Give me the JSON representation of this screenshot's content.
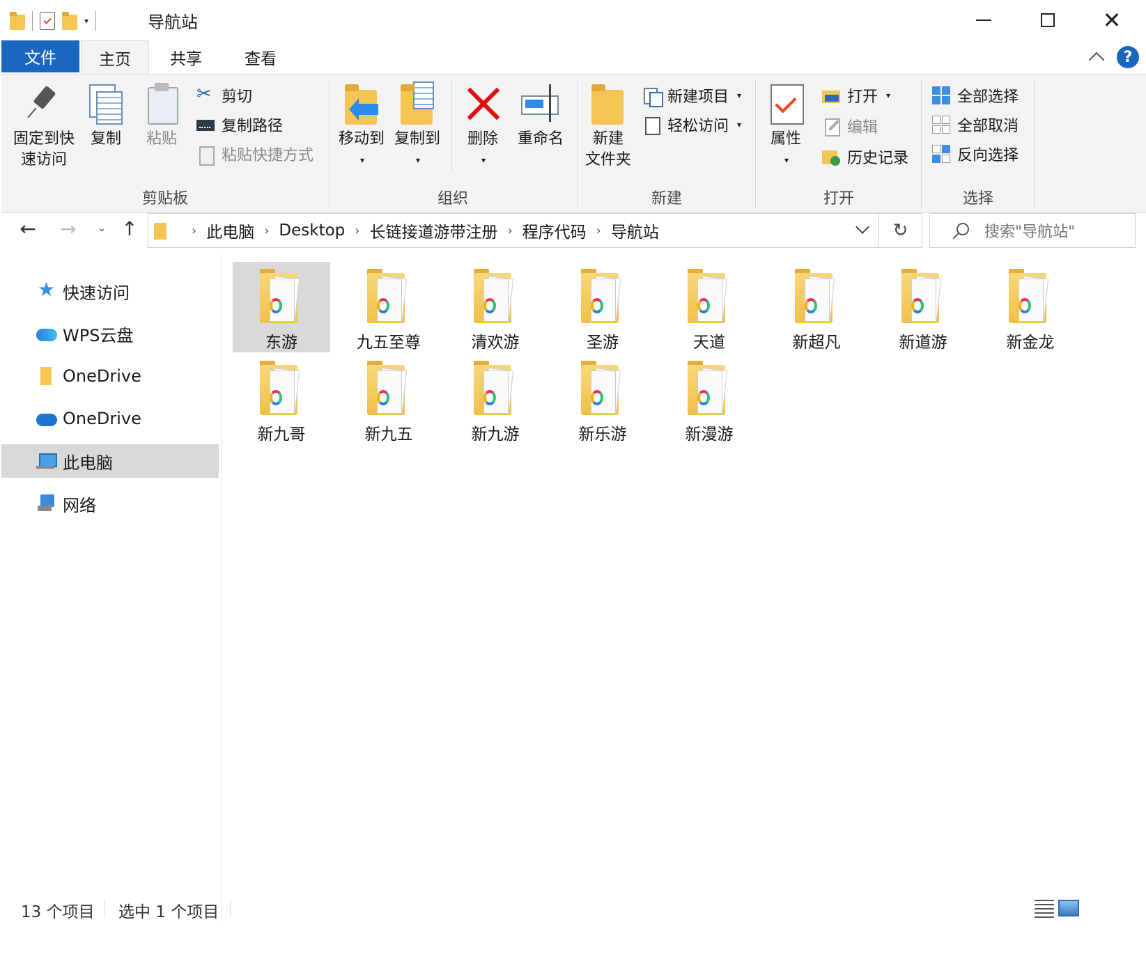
{
  "window": {
    "title": "导航站",
    "qat_dropdown": "▾",
    "minimize": "",
    "maximize": "",
    "close": "✕"
  },
  "tabs": {
    "file": "文件",
    "home": "主页",
    "share": "共享",
    "view": "查看",
    "help": "?"
  },
  "ribbon": {
    "clipboard": {
      "label": "剪贴板",
      "pin_line1": "固定到快",
      "pin_line2": "速访问",
      "copy": "复制",
      "paste": "粘贴",
      "cut": "剪切",
      "copy_path": "复制路径",
      "paste_shortcut": "粘贴快捷方式"
    },
    "organize": {
      "label": "组织",
      "move_to": "移动到",
      "copy_to": "复制到",
      "delete": "删除",
      "rename": "重命名"
    },
    "new": {
      "label": "新建",
      "new_folder_line1": "新建",
      "new_folder_line2": "文件夹",
      "new_item": "新建项目",
      "easy_access": "轻松访问"
    },
    "open": {
      "label": "打开",
      "properties": "属性",
      "open": "打开",
      "edit": "编辑",
      "history": "历史记录"
    },
    "select": {
      "label": "选择",
      "select_all": "全部选择",
      "select_none": "全部取消",
      "invert": "反向选择"
    }
  },
  "nav": {
    "back": "←",
    "forward": "→",
    "recent": "⌄",
    "up": "↑",
    "refresh": "↻"
  },
  "breadcrumb": [
    "此电脑",
    "Desktop",
    "长链接道游带注册",
    "程序代码",
    "导航站"
  ],
  "search": {
    "placeholder": "搜索\"导航站\""
  },
  "sidebar": {
    "items": [
      {
        "label": "快速访问",
        "icon": "star-icon"
      },
      {
        "label": "WPS云盘",
        "icon": "cloud-icon"
      },
      {
        "label": "OneDrive",
        "icon": "folder-icon"
      },
      {
        "label": "OneDrive",
        "icon": "cloud-icon"
      },
      {
        "label": "此电脑",
        "icon": "pc-icon",
        "selected": true
      },
      {
        "label": "网络",
        "icon": "network-icon"
      }
    ]
  },
  "files": [
    {
      "name": "东游",
      "selected": true
    },
    {
      "name": "九五至尊"
    },
    {
      "name": "清欢游"
    },
    {
      "name": "圣游"
    },
    {
      "name": "天道"
    },
    {
      "name": "新超凡"
    },
    {
      "name": "新道游"
    },
    {
      "name": "新金龙"
    },
    {
      "name": "新九哥"
    },
    {
      "name": "新九五"
    },
    {
      "name": "新九游"
    },
    {
      "name": "新乐游"
    },
    {
      "name": "新漫游"
    }
  ],
  "status": {
    "count": "13 个项目",
    "selection": "选中 1 个项目"
  }
}
